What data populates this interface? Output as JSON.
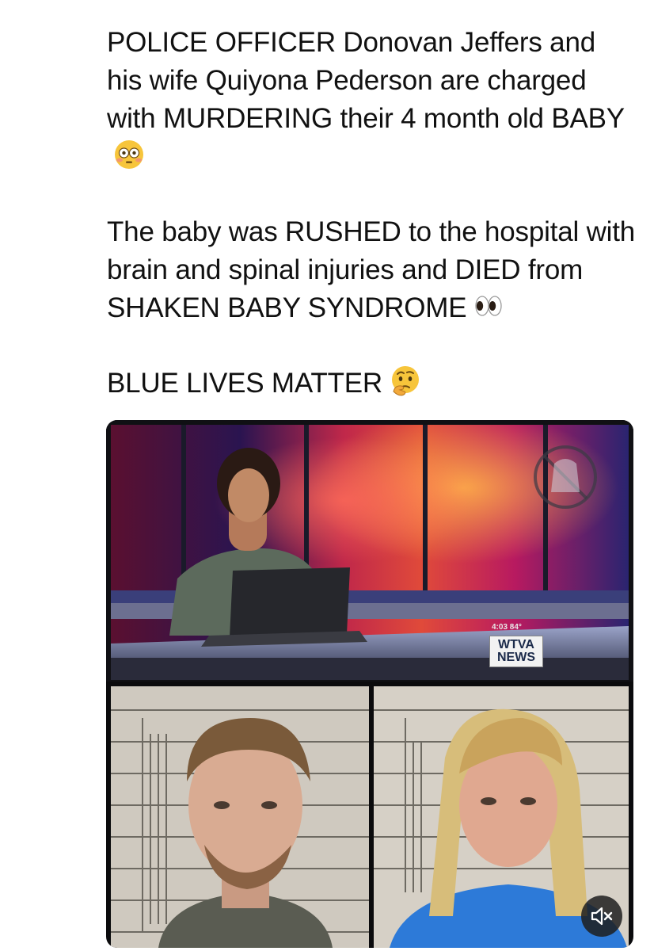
{
  "post": {
    "paragraph1": "POLICE OFFICER Donovan Jeffers and his wife Quiyona Pederson are charged with MURDERING their 4 month old BABY",
    "paragraph2": "The baby was RUSHED to the hospital with brain and spinal injuries and DIED from SHAKEN BABY SYNDROME",
    "paragraph3": "BLUE LIVES MATTER",
    "emoji1": "flushed-face-emoji",
    "emoji2": "eyes-emoji",
    "emoji3": "thinking-face-emoji"
  },
  "media": {
    "station_logo_line1": "WTVA",
    "station_logo_line2": "NEWS",
    "clock_text": "4:03  84°",
    "mute_icon": "speaker-muted-icon"
  }
}
